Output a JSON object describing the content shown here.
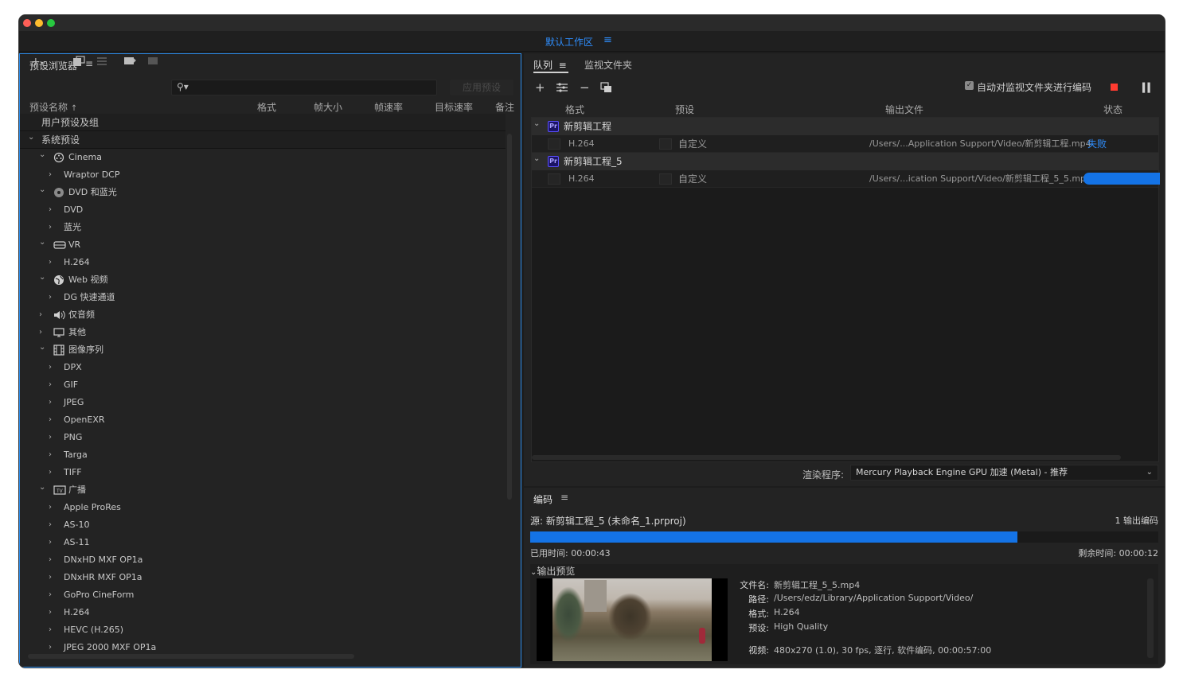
{
  "workspace": {
    "title": "默认工作区",
    "menu_icon": "≡"
  },
  "preset_browser": {
    "title": "预设浏览器",
    "apply_button": "应用预设",
    "columns": [
      "预设名称",
      "格式",
      "帧大小",
      "帧速率",
      "目标速率",
      "备注"
    ],
    "tree": [
      {
        "label": "用户预设及组",
        "level": 0,
        "kind": "group",
        "chev": "",
        "icon": ""
      },
      {
        "label": "系统预设",
        "level": 0,
        "kind": "group",
        "chev": "down",
        "icon": ""
      },
      {
        "label": "Cinema",
        "level": 1,
        "kind": "category",
        "chev": "down",
        "icon": "film-reel-icon"
      },
      {
        "label": "Wraptor DCP",
        "level": 2,
        "kind": "item",
        "chev": "right",
        "icon": ""
      },
      {
        "label": "DVD 和蓝光",
        "level": 1,
        "kind": "category",
        "chev": "down",
        "icon": "disc-icon"
      },
      {
        "label": "DVD",
        "level": 2,
        "kind": "item",
        "chev": "right",
        "icon": ""
      },
      {
        "label": "蓝光",
        "level": 2,
        "kind": "item",
        "chev": "right",
        "icon": ""
      },
      {
        "label": "VR",
        "level": 1,
        "kind": "category",
        "chev": "down",
        "icon": "vr-headset-icon"
      },
      {
        "label": "H.264",
        "level": 2,
        "kind": "item",
        "chev": "right",
        "icon": ""
      },
      {
        "label": "Web 视频",
        "level": 1,
        "kind": "category",
        "chev": "down",
        "icon": "globe-icon"
      },
      {
        "label": "DG 快速通道",
        "level": 2,
        "kind": "item",
        "chev": "right",
        "icon": ""
      },
      {
        "label": "仅音频",
        "level": 1,
        "kind": "category",
        "chev": "right",
        "icon": "speaker-icon"
      },
      {
        "label": "其他",
        "level": 1,
        "kind": "category",
        "chev": "right",
        "icon": "monitor-icon"
      },
      {
        "label": "图像序列",
        "level": 1,
        "kind": "category",
        "chev": "down",
        "icon": "film-strip-icon"
      },
      {
        "label": "DPX",
        "level": 2,
        "kind": "item",
        "chev": "right",
        "icon": ""
      },
      {
        "label": "GIF",
        "level": 2,
        "kind": "item",
        "chev": "right",
        "icon": ""
      },
      {
        "label": "JPEG",
        "level": 2,
        "kind": "item",
        "chev": "right",
        "icon": ""
      },
      {
        "label": "OpenEXR",
        "level": 2,
        "kind": "item",
        "chev": "right",
        "icon": ""
      },
      {
        "label": "PNG",
        "level": 2,
        "kind": "item",
        "chev": "right",
        "icon": ""
      },
      {
        "label": "Targa",
        "level": 2,
        "kind": "item",
        "chev": "right",
        "icon": ""
      },
      {
        "label": "TIFF",
        "level": 2,
        "kind": "item",
        "chev": "right",
        "icon": ""
      },
      {
        "label": "广播",
        "level": 1,
        "kind": "category",
        "chev": "down",
        "icon": "tv-icon"
      },
      {
        "label": "Apple ProRes",
        "level": 2,
        "kind": "item",
        "chev": "right",
        "icon": ""
      },
      {
        "label": "AS-10",
        "level": 2,
        "kind": "item",
        "chev": "right",
        "icon": ""
      },
      {
        "label": "AS-11",
        "level": 2,
        "kind": "item",
        "chev": "right",
        "icon": ""
      },
      {
        "label": "DNxHD MXF OP1a",
        "level": 2,
        "kind": "item",
        "chev": "right",
        "icon": ""
      },
      {
        "label": "DNxHR MXF OP1a",
        "level": 2,
        "kind": "item",
        "chev": "right",
        "icon": ""
      },
      {
        "label": "GoPro CineForm",
        "level": 2,
        "kind": "item",
        "chev": "right",
        "icon": ""
      },
      {
        "label": "H.264",
        "level": 2,
        "kind": "item",
        "chev": "right",
        "icon": ""
      },
      {
        "label": "HEVC (H.265)",
        "level": 2,
        "kind": "item",
        "chev": "right",
        "icon": ""
      },
      {
        "label": "JPEG 2000 MXF OP1a",
        "level": 2,
        "kind": "item",
        "chev": "right",
        "icon": ""
      }
    ]
  },
  "queue": {
    "tabs": [
      "队列",
      "监视文件夹"
    ],
    "auto_encode_label": "自动对监视文件夹进行编码",
    "auto_encode_checked": true,
    "columns": [
      "格式",
      "预设",
      "输出文件",
      "状态"
    ],
    "projects": [
      {
        "name": "新剪辑工程",
        "badge": "Pr",
        "items": [
          {
            "format": "H.264",
            "preset": "自定义",
            "output": "/Users/...Application Support/Video/新剪辑工程.mp4",
            "status": "失败",
            "status_kind": "fail",
            "progress": null
          }
        ]
      },
      {
        "name": "新剪辑工程_5",
        "badge": "Pr",
        "items": [
          {
            "format": "H.264",
            "preset": "自定义",
            "output": "/Users/...ication Support/Video/新剪辑工程_5_5.mp4",
            "status": "",
            "status_kind": "encoding",
            "progress": 1.0
          }
        ]
      }
    ],
    "renderer_label": "渲染程序:",
    "renderer_value": "Mercury Playback Engine GPU 加速 (Metal) - 推荐"
  },
  "encoding": {
    "title": "编码",
    "source": "源: 新剪辑工程_5 (未命名_1.prproj)",
    "output_count": "1 输出编码",
    "progress": 0.776,
    "elapsed": "已用时间: 00:00:43",
    "remaining": "剩余时间: 00:00:12",
    "preview_label": "输出预览",
    "info": [
      {
        "label": "文件名:",
        "value": "新剪辑工程_5_5.mp4"
      },
      {
        "label": "路径:",
        "value": "/Users/edz/Library/Application Support/Video/"
      },
      {
        "label": "格式:",
        "value": "H.264"
      },
      {
        "label": "预设:",
        "value": "High Quality"
      },
      {
        "label": "视频:",
        "value": "480x270 (1.0), 30 fps, 逐行, 软件编码, 00:00:57:00"
      }
    ]
  },
  "colors": {
    "accent": "#1473e6",
    "focus_border": "#2d8ceb",
    "fail": "#2f8fff",
    "stop": "#ff3b30"
  }
}
